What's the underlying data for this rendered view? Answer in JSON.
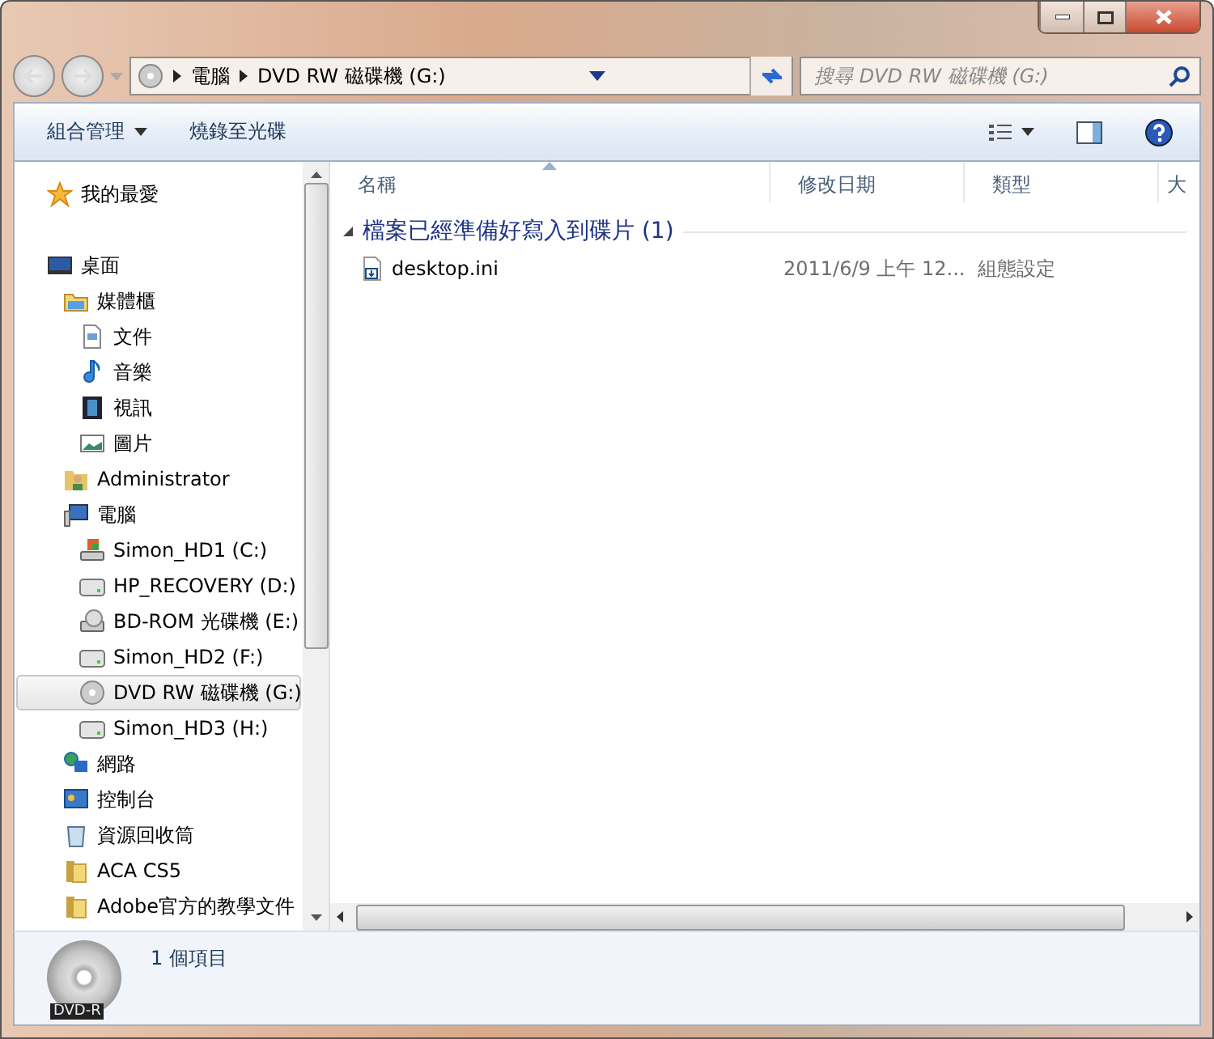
{
  "address": {
    "crumbs": [
      "電腦",
      "DVD RW 磁碟機 (G:)"
    ]
  },
  "search": {
    "placeholder": "搜尋 DVD RW 磁碟機 (G:)"
  },
  "toolbar": {
    "items": [
      "組合管理",
      "燒錄至光碟"
    ]
  },
  "sidebar": {
    "items": [
      {
        "label": "我的最愛",
        "kind": "star",
        "selected": false
      },
      {
        "label": "桌面",
        "kind": "desktop",
        "selected": false,
        "children": [
          {
            "label": "媒體櫃",
            "kind": "library",
            "selected": false,
            "children": [
              {
                "label": "文件",
                "kind": "doc",
                "selected": false
              },
              {
                "label": "音樂",
                "kind": "music",
                "selected": false
              },
              {
                "label": "視訊",
                "kind": "video",
                "selected": false
              },
              {
                "label": "圖片",
                "kind": "picture",
                "selected": false
              }
            ]
          },
          {
            "label": "Administrator",
            "kind": "user",
            "selected": false
          },
          {
            "label": "電腦",
            "kind": "computer",
            "selected": false,
            "children": [
              {
                "label": "Simon_HD1 (C:)",
                "kind": "windrive",
                "selected": false
              },
              {
                "label": "HP_RECOVERY (D:)",
                "kind": "drive",
                "selected": false
              },
              {
                "label": "BD-ROM 光碟機 (E:)",
                "kind": "optical",
                "selected": false
              },
              {
                "label": "Simon_HD2 (F:)",
                "kind": "drive",
                "selected": false
              },
              {
                "label": "DVD RW 磁碟機 (G:)",
                "kind": "disc",
                "selected": true
              },
              {
                "label": "Simon_HD3 (H:)",
                "kind": "drive",
                "selected": false
              }
            ]
          },
          {
            "label": "網路",
            "kind": "network",
            "selected": false
          },
          {
            "label": "控制台",
            "kind": "control",
            "selected": false
          },
          {
            "label": "資源回收筒",
            "kind": "recycle",
            "selected": false
          },
          {
            "label": "ACA CS5",
            "kind": "folder",
            "selected": false
          },
          {
            "label": "Adobe官方的教學文件",
            "kind": "folder",
            "selected": false
          }
        ]
      }
    ]
  },
  "columns": [
    {
      "label": "名稱",
      "sorted": true
    },
    {
      "label": "修改日期",
      "sorted": false
    },
    {
      "label": "類型",
      "sorted": false
    },
    {
      "label": "大",
      "sorted": false
    }
  ],
  "groups": [
    {
      "title": "檔案已經準備好寫入到碟片 (1)",
      "expanded": true,
      "files": [
        {
          "name": "desktop.ini",
          "date": "2011/6/9 上午 12...",
          "type": "組態設定"
        }
      ]
    }
  ],
  "details": {
    "badge": "DVD-R",
    "summary": "1 個項目"
  }
}
